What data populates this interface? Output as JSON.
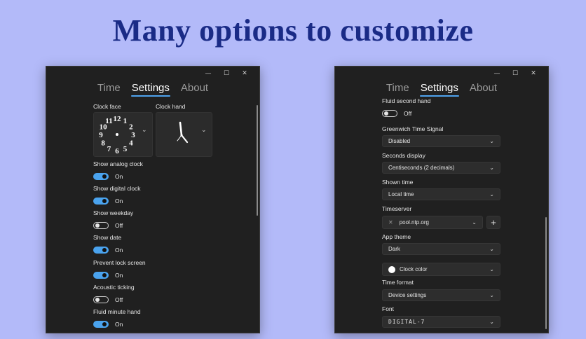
{
  "headline": "Many options to customize",
  "window_controls": {
    "minimize": "—",
    "maximize": "☐",
    "close": "✕"
  },
  "tabs": [
    {
      "label": "Time"
    },
    {
      "label": "Settings"
    },
    {
      "label": "About"
    }
  ],
  "left": {
    "clock_face_label": "Clock face",
    "clock_hand_label": "Clock hand",
    "clock_face_numerals": [
      "12",
      "1",
      "2",
      "3",
      "4",
      "5",
      "6",
      "7",
      "8",
      "9",
      "10",
      "11"
    ],
    "chevron": "⌄",
    "toggles": [
      {
        "label": "Show analog clock",
        "state": "On",
        "on": true
      },
      {
        "label": "Show digital clock",
        "state": "On",
        "on": true
      },
      {
        "label": "Show weekday",
        "state": "Off",
        "on": false
      },
      {
        "label": "Show date",
        "state": "On",
        "on": true
      },
      {
        "label": "Prevent lock screen",
        "state": "On",
        "on": true
      },
      {
        "label": "Acoustic ticking",
        "state": "Off",
        "on": false
      },
      {
        "label": "Fluid minute hand",
        "state": "On",
        "on": true
      }
    ]
  },
  "right": {
    "fluid_second": {
      "label": "Fluid second hand",
      "state": "Off",
      "on": false
    },
    "greenwich": {
      "label": "Greenwich Time Signal",
      "value": "Disabled"
    },
    "seconds_display": {
      "label": "Seconds display",
      "value": "Centiseconds (2 decimals)"
    },
    "shown_time": {
      "label": "Shown time",
      "value": "Local time"
    },
    "timeserver": {
      "label": "Timeserver",
      "value": "pool.ntp.org",
      "remove_icon": "✕",
      "add_icon": "+"
    },
    "app_theme": {
      "label": "App theme",
      "value": "Dark"
    },
    "clock_color": {
      "value": "Clock color"
    },
    "time_format": {
      "label": "Time format",
      "value": "Device settings"
    },
    "font": {
      "label": "Font",
      "value": "DIGITAL-7"
    }
  },
  "colors": {
    "background": "#b3baf9",
    "headline": "#1a2b86",
    "window": "#202020",
    "accent": "#4aa3ee"
  }
}
